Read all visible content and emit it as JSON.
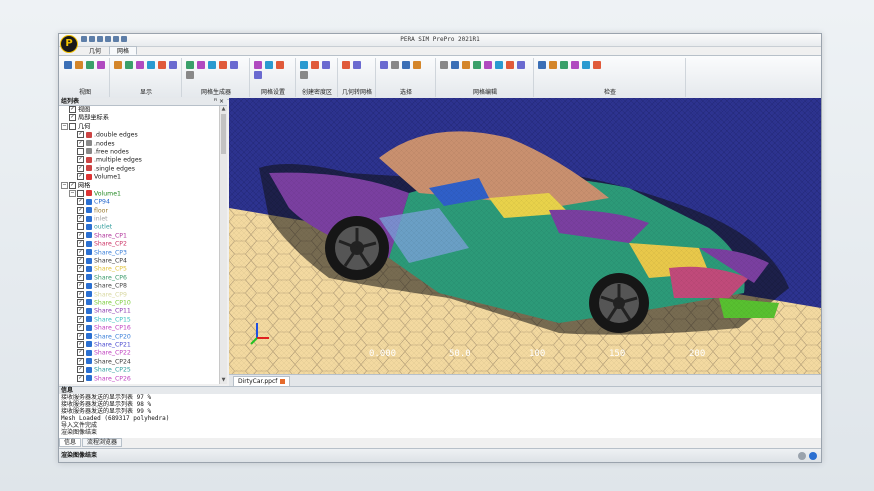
{
  "window": {
    "title": "PERA SIM PrePro 2021R1",
    "logo_letter": "P"
  },
  "tabs": [
    {
      "label": "几何",
      "active": false
    },
    {
      "label": "网格",
      "active": true
    }
  ],
  "ribbon_groups": [
    {
      "label": "视图",
      "icons": [
        "view-fit-icon",
        "camera-icon",
        "rotate-icon",
        "zoom-icon"
      ]
    },
    {
      "label": "显示",
      "icons": [
        "color-icon",
        "light-icon",
        "mesh-display-icon",
        "surface-icon",
        "edge-icon",
        "node-icon"
      ]
    },
    {
      "label": "网格生成器",
      "icons": [
        "grid-icon",
        "layers-icon",
        "refine-icon",
        "boundary-icon",
        "cell-icon",
        "smooth-icon"
      ]
    },
    {
      "label": "网格设置",
      "icons": [
        "settings-icon",
        "size-icon",
        "prism-icon",
        "poly-icon"
      ]
    },
    {
      "label": "创建密度区",
      "icons": [
        "box-region-icon",
        "cylinder-region-icon",
        "sphere-region-icon",
        "cone-region-icon"
      ]
    },
    {
      "label": "几何转网格",
      "icons": [
        "convert-icon",
        "surface-mesh-icon"
      ]
    },
    {
      "label": "选择",
      "icons": [
        "pick-icon",
        "box-select-icon",
        "lasso-icon",
        "invert-select-icon"
      ]
    },
    {
      "label": "网格编辑",
      "icons": [
        "split-icon",
        "merge-icon",
        "collapse-icon",
        "swap-icon",
        "move-node-icon",
        "delete-cell-icon",
        "fill-hole-icon",
        "repair-icon"
      ]
    },
    {
      "label": "检查",
      "icons": [
        "quality-icon",
        "histogram-icon",
        "check-icon",
        "report-icon",
        "probe-icon",
        "stats-icon"
      ]
    }
  ],
  "tree_panel": {
    "title": "组列表",
    "pin": "ꟸ ×",
    "rows": [
      {
        "label": "视图",
        "depth": 1,
        "exp": "",
        "checked": true,
        "icon": "",
        "color": "#000"
      },
      {
        "label": "局部坐标系",
        "depth": 1,
        "exp": "",
        "checked": true,
        "icon": "",
        "color": "#000"
      },
      {
        "label": "几何",
        "depth": 0,
        "exp": "−",
        "checked": false,
        "icon": "",
        "color": "#000"
      },
      {
        "label": ".double edges",
        "depth": 2,
        "exp": "",
        "checked": true,
        "icon": "#c44",
        "color": "#222"
      },
      {
        "label": ".nodes",
        "depth": 2,
        "exp": "",
        "checked": true,
        "icon": "#888",
        "color": "#222"
      },
      {
        "label": ".free nodes",
        "depth": 2,
        "exp": "",
        "checked": false,
        "icon": "#888",
        "color": "#222"
      },
      {
        "label": ".multiple edges",
        "depth": 2,
        "exp": "",
        "checked": true,
        "icon": "#c44",
        "color": "#222"
      },
      {
        "label": ".single edges",
        "depth": 2,
        "exp": "",
        "checked": true,
        "icon": "#c44",
        "color": "#222"
      },
      {
        "label": "Volume1",
        "depth": 2,
        "exp": "",
        "checked": true,
        "icon": "#d33",
        "color": "#222"
      },
      {
        "label": "网格",
        "depth": 0,
        "exp": "−",
        "checked": true,
        "icon": "",
        "color": "#000"
      },
      {
        "label": "Volume1",
        "depth": 1,
        "exp": "−",
        "checked": false,
        "icon": "#d33",
        "color": "#228822"
      },
      {
        "label": "CP94",
        "depth": 2,
        "exp": "",
        "checked": true,
        "icon": "#2a6fd1",
        "color": "#2266cc"
      },
      {
        "label": "floor",
        "depth": 2,
        "exp": "",
        "checked": true,
        "icon": "#2a6fd1",
        "color": "#9a7a30"
      },
      {
        "label": "inlet",
        "depth": 2,
        "exp": "",
        "checked": true,
        "icon": "#2a6fd1",
        "color": "#a0a0a0"
      },
      {
        "label": "outlet",
        "depth": 2,
        "exp": "",
        "checked": false,
        "icon": "#2a6fd1",
        "color": "#3aa0a0"
      },
      {
        "label": "Share_CP1",
        "depth": 2,
        "exp": "",
        "checked": true,
        "icon": "#2a6fd1",
        "color": "#b0339b"
      },
      {
        "label": "Share_CP2",
        "depth": 2,
        "exp": "",
        "checked": true,
        "icon": "#2a6fd1",
        "color": "#cc3366"
      },
      {
        "label": "Share_CP3",
        "depth": 2,
        "exp": "",
        "checked": true,
        "icon": "#2a6fd1",
        "color": "#3a7fd9"
      },
      {
        "label": "Share_CP4",
        "depth": 2,
        "exp": "",
        "checked": true,
        "icon": "#2a6fd1",
        "color": "#3a3a3a"
      },
      {
        "label": "Share_CP5",
        "depth": 2,
        "exp": "",
        "checked": true,
        "icon": "#2a6fd1",
        "color": "#e0c23a"
      },
      {
        "label": "Share_CP6",
        "depth": 2,
        "exp": "",
        "checked": true,
        "icon": "#2a6fd1",
        "color": "#3a9a6a"
      },
      {
        "label": "Share_CP8",
        "depth": 2,
        "exp": "",
        "checked": true,
        "icon": "#2a6fd1",
        "color": "#444"
      },
      {
        "label": "Share_CP9",
        "depth": 2,
        "exp": "",
        "checked": true,
        "icon": "#2a6fd1",
        "color": "#d8d8a0"
      },
      {
        "label": "Share_CP10",
        "depth": 2,
        "exp": "",
        "checked": true,
        "icon": "#2a6fd1",
        "color": "#7acc3a"
      },
      {
        "label": "Share_CP11",
        "depth": 2,
        "exp": "",
        "checked": true,
        "icon": "#2a6fd1",
        "color": "#8a3ab0"
      },
      {
        "label": "Share_CP15",
        "depth": 2,
        "exp": "",
        "checked": true,
        "icon": "#2a6fd1",
        "color": "#3ac0c0"
      },
      {
        "label": "Share_CP16",
        "depth": 2,
        "exp": "",
        "checked": true,
        "icon": "#2a6fd1",
        "color": "#c040c0"
      },
      {
        "label": "Share_CP20",
        "depth": 2,
        "exp": "",
        "checked": true,
        "icon": "#2a6fd1",
        "color": "#3a7fd9"
      },
      {
        "label": "Share_CP21",
        "depth": 2,
        "exp": "",
        "checked": true,
        "icon": "#2a6fd1",
        "color": "#4a4ad0"
      },
      {
        "label": "Share_CP22",
        "depth": 2,
        "exp": "",
        "checked": true,
        "icon": "#2a6fd1",
        "color": "#c040c0"
      },
      {
        "label": "Share_CP24",
        "depth": 2,
        "exp": "",
        "checked": true,
        "icon": "#2a6fd1",
        "color": "#3a3a3a"
      },
      {
        "label": "Share_CP25",
        "depth": 2,
        "exp": "",
        "checked": true,
        "icon": "#2a6fd1",
        "color": "#30a0a0"
      },
      {
        "label": "Share_CP26",
        "depth": 2,
        "exp": "",
        "checked": true,
        "icon": "#2a6fd1",
        "color": "#c040c0"
      }
    ]
  },
  "viewport": {
    "document_tab": "DirtyCar.ppcf",
    "scale_labels": [
      "0.000",
      "50.0",
      "100",
      "150",
      "200"
    ],
    "colors": {
      "background": "#2d3390",
      "floor": "#f3d9a0",
      "floor_line": "#b8a27a",
      "body_main": "#2c9a78",
      "body_purple": "#7a3fa0"
    }
  },
  "info_panel": {
    "title": "信息",
    "lines": [
      "接收服务器发送的显示列表 97 %",
      "接收服务器发送的显示列表 98 %",
      "接收服务器发送的显示列表 99 %",
      "Mesh Loaded (689317 polyhedra)",
      "导入文件完成",
      "渲染图像结束"
    ],
    "tabs": [
      {
        "label": "信息",
        "active": true
      },
      {
        "label": "流程浏览器",
        "active": false
      }
    ]
  },
  "status": {
    "text": "渲染图像结束"
  }
}
